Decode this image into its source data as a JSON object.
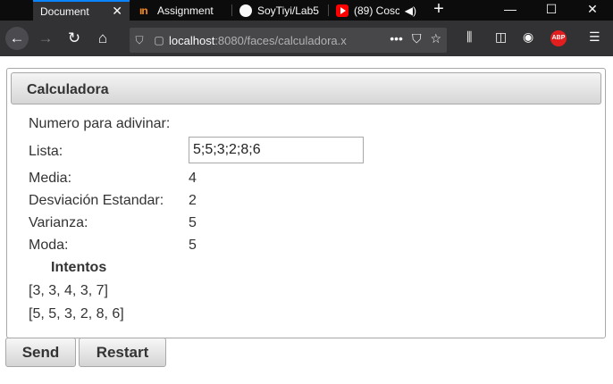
{
  "browser": {
    "tabs": [
      {
        "label": "Document",
        "active": true
      },
      {
        "label": "Assignment"
      },
      {
        "label": "SoyTiyi/Lab5"
      },
      {
        "label": "(89) Cosc"
      }
    ],
    "url_host": "localhost",
    "url_rest": ":8080/faces/calculadora.x"
  },
  "panel": {
    "title": "Calculadora"
  },
  "form": {
    "numero_label": "Numero para adivinar:",
    "lista_label": "Lista:",
    "lista_value": "5;5;3;2;8;6",
    "media_label": "Media:",
    "media_value": "4",
    "desviacion_label": "Desviación Estandar:",
    "desviacion_value": "2",
    "varianza_label": "Varianza:",
    "varianza_value": "5",
    "moda_label": "Moda:",
    "moda_value": "5"
  },
  "intentos": {
    "title": "Intentos",
    "items": [
      "[3, 3, 4, 3, 7]",
      "[5, 5, 3, 2, 8, 6]"
    ]
  },
  "buttons": {
    "send": "Send",
    "restart": "Restart"
  },
  "colors": {
    "tab_strip": "#0c0c0d",
    "toolbar": "#323234",
    "active_tab_accent": "#0a84ff"
  }
}
